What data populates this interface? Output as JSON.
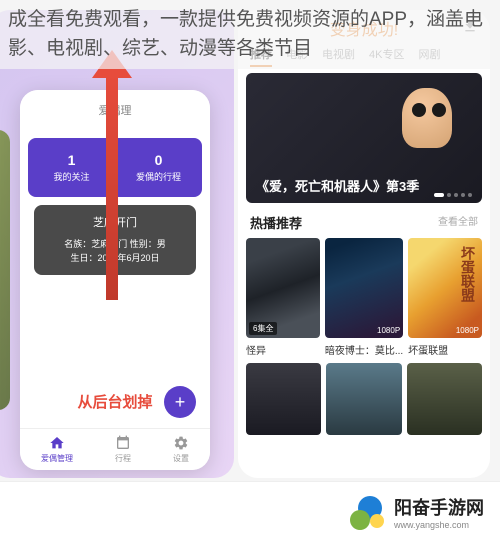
{
  "overlay_description": "成全看免费观看，一款提供免费视频资源的APP，涵盖电影、电视剧、综艺、动漫等各类节目",
  "left": {
    "header_title": "爱偶理",
    "stats": [
      {
        "num": "1",
        "label": "我的关注"
      },
      {
        "num": "0",
        "label": "爱偶的行程"
      }
    ],
    "card": {
      "title": "芝麻开门",
      "line1": "名族：芝麻开门    性别：男",
      "line2": "生日：2023年6月20日"
    },
    "swipe_hint": "从后台划掉",
    "fab": "+",
    "nav": [
      {
        "label": "爱偶管理",
        "active": true
      },
      {
        "label": "行程",
        "active": false
      },
      {
        "label": "设置",
        "active": false
      }
    ]
  },
  "right": {
    "success": "变身成功!",
    "tabs": [
      {
        "label": "推荐",
        "active": true
      },
      {
        "label": "电影",
        "active": false
      },
      {
        "label": "电视剧",
        "active": false
      },
      {
        "label": "4K专区",
        "active": false
      },
      {
        "label": "网剧",
        "active": false
      }
    ],
    "hero_title": "《爱，死亡和机器人》第3季",
    "section": {
      "title": "热播推荐",
      "more": "查看全部"
    },
    "posters": [
      {
        "name": "怪异",
        "badge": "6集全",
        "quality": ""
      },
      {
        "name": "暗夜博士：莫比...",
        "badge": "",
        "quality": "1080P"
      },
      {
        "name": "坏蛋联盟",
        "badge": "",
        "quality": "1080P",
        "caption": "坏蛋联盟"
      }
    ]
  },
  "footer": {
    "brand": "阳奋手游网",
    "url": "www.yangshe.com"
  }
}
